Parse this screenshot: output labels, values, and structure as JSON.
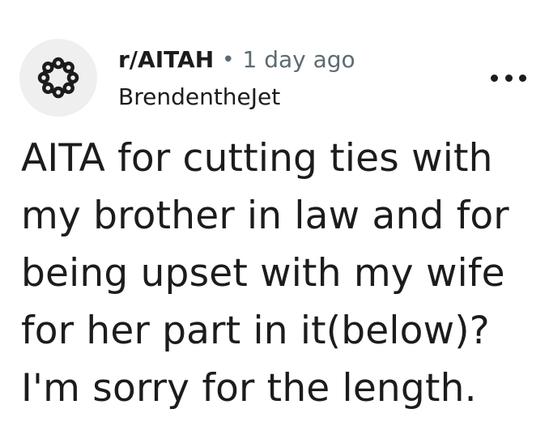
{
  "post": {
    "subreddit": "r/AITAH",
    "separator": "•",
    "time": "1 day ago",
    "author": "BrendentheJet",
    "avatar_icon": "community-ring-icon",
    "more_icon": "more-options-icon",
    "title": "AITA for cutting ties with my brother in law and for being upset with my wife for her part in it(below)? I'm sorry for the length."
  },
  "colors": {
    "text": "#1c1c1c",
    "muted": "#5c6b73",
    "avatar_bg": "#efefef"
  }
}
